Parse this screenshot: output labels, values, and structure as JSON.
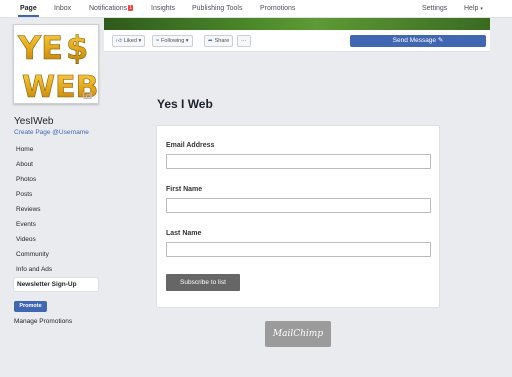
{
  "topbar": {
    "tabs": {
      "page": "Page",
      "inbox": "Inbox",
      "notifications": "Notifications",
      "notifications_count": "1",
      "insights": "Insights",
      "publishing_tools": "Publishing Tools",
      "promotions": "Promotions"
    },
    "settings": "Settings",
    "help": "Help",
    "help_caret": "▾"
  },
  "profile": {
    "logo_text": "YES WEB",
    "name": "YesIWeb",
    "username_link": "Create Page @Username"
  },
  "sidebar": {
    "items": [
      {
        "label": "Home"
      },
      {
        "label": "About"
      },
      {
        "label": "Photos"
      },
      {
        "label": "Posts"
      },
      {
        "label": "Reviews"
      },
      {
        "label": "Events"
      },
      {
        "label": "Videos"
      },
      {
        "label": "Community"
      },
      {
        "label": "Info and Ads"
      },
      {
        "label": "Newsletter Sign-Up"
      }
    ],
    "promote_label": "Promote",
    "manage_promotions": "Manage Promotions"
  },
  "actions": {
    "liked": "Liked",
    "following": "Following",
    "share": "Share",
    "more": "···",
    "send_message": "Send Message"
  },
  "content": {
    "title": "Yes I Web",
    "form": {
      "email_label": "Email Address",
      "email_value": "",
      "first_name_label": "First Name",
      "first_name_value": "",
      "last_name_label": "Last Name",
      "last_name_value": "",
      "submit_label": "Subscribe to list"
    },
    "badge": "MailChimp"
  },
  "colors": {
    "accent": "#4267b2",
    "notification": "#fa3e3e",
    "subscribe_button": "#666666",
    "logo_gold": "#e8b820"
  },
  "icons": [
    "thumbs-up-icon",
    "rss-icon",
    "share-arrow-icon",
    "pencil-icon",
    "camera-icon",
    "caret-down-icon"
  ]
}
